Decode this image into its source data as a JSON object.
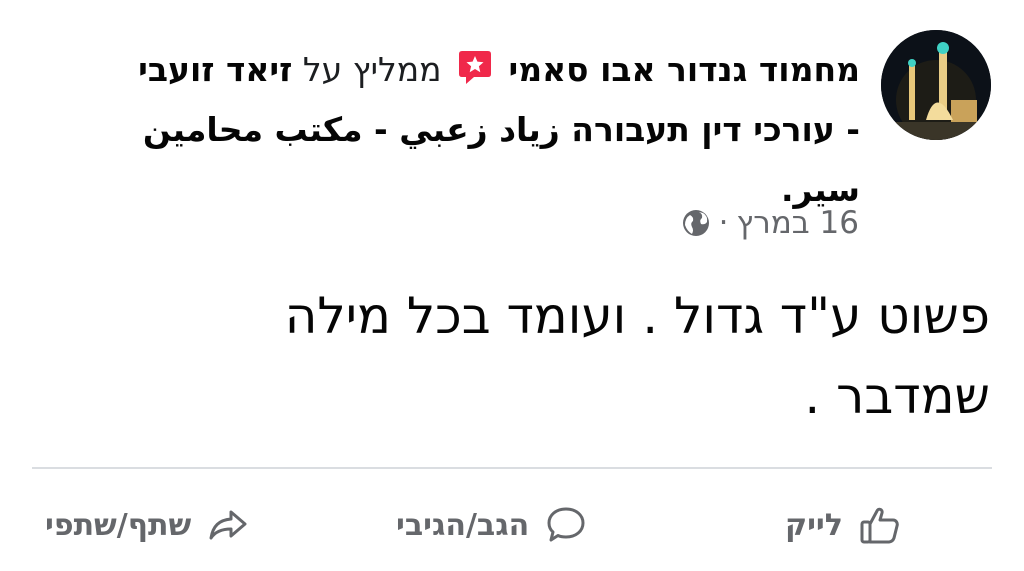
{
  "post": {
    "author": "מחמוד גנדור אבו סאמי",
    "recommends_text": "ממליץ על",
    "page_name_part1": "זיאד זועבי",
    "page_name_part2": "- עורכי דין תעבורה زياد زعبي -  مكتب محامين",
    "page_name_part3": "سير.",
    "date": "16 במרץ",
    "separator": "·",
    "body_line1": "פשוט ע\"ד גדול . ועומד בכל מילה",
    "body_line2": "שמדבר ."
  },
  "actions": {
    "like": "לייק",
    "comment": "הגב/הגיבי",
    "share": "שתף/שתפי"
  },
  "icons": {
    "avatar": "mosque-night-avatar",
    "recommend": "recommendation-star-icon",
    "privacy": "globe-icon",
    "like": "thumbs-up-icon",
    "comment": "comment-bubble-icon",
    "share": "share-arrow-icon"
  },
  "colors": {
    "recommend_badge": "#f0284a",
    "secondary_text": "#65676b",
    "divider": "#dadde1"
  }
}
